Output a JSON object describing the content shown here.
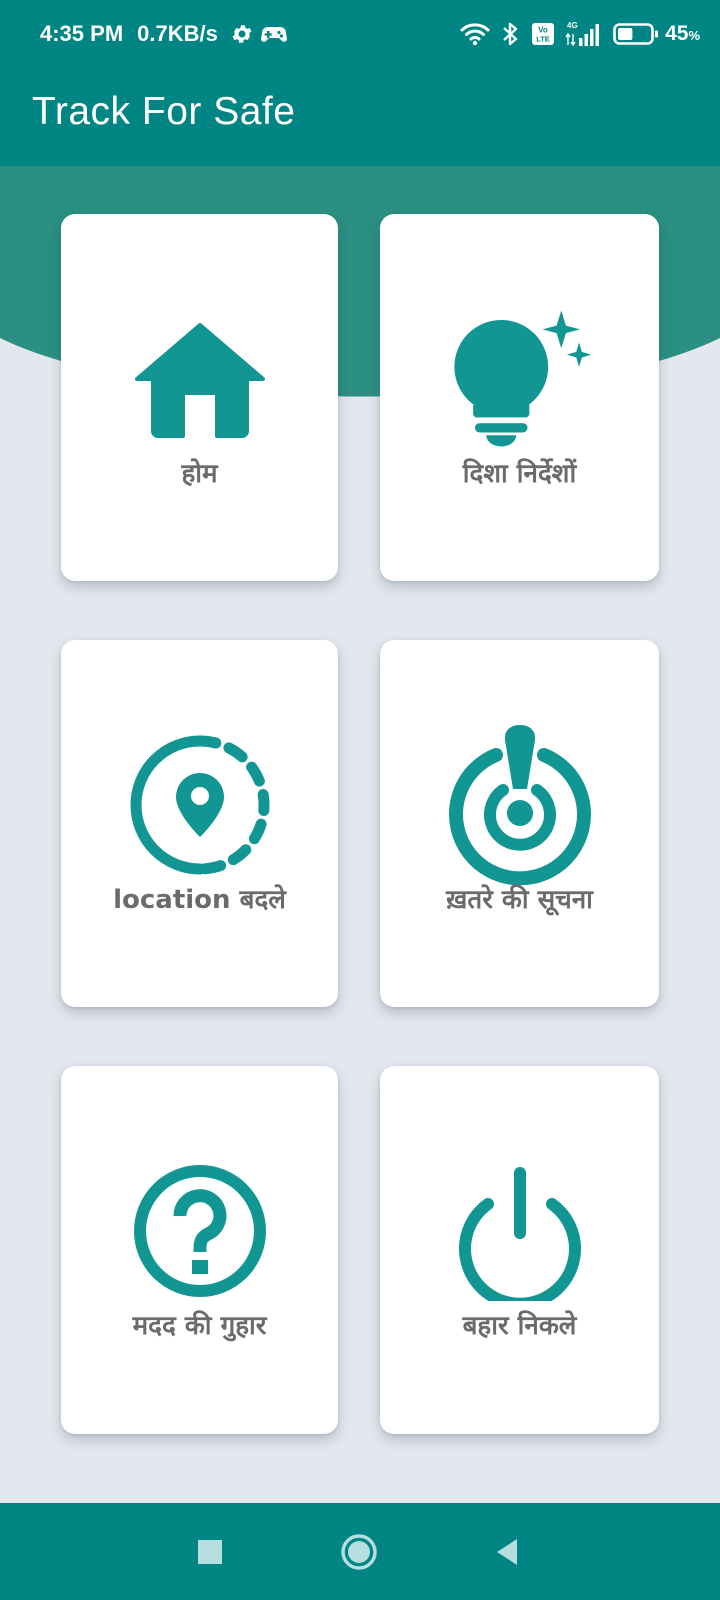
{
  "status_bar": {
    "time": "4:35 PM",
    "network_speed": "0.7KB/s",
    "battery_percent": "45",
    "battery_unit": "%",
    "battery_level": 0.45,
    "network_type": "4G",
    "volte_label": "Vo LTE",
    "icons": [
      "settings-icon",
      "game-controller-icon",
      "wifi-icon",
      "bluetooth-icon",
      "volte-icon",
      "signal-icon",
      "battery-icon"
    ]
  },
  "app_bar": {
    "title": "Track For Safe"
  },
  "tiles": [
    {
      "label": "होम",
      "icon": "home-icon"
    },
    {
      "label": "दिशा निर्देशों",
      "icon": "lightbulb-sparkle-icon"
    },
    {
      "label": "location बदले",
      "icon": "location-change-icon"
    },
    {
      "label": "ख़तरे की सूचना",
      "icon": "danger-alert-icon"
    },
    {
      "label": "मदद की गुहार",
      "icon": "help-icon"
    },
    {
      "label": "बहार निकले",
      "icon": "power-icon"
    }
  ],
  "navigation": {
    "buttons": [
      "recents-button",
      "home-button",
      "back-button"
    ]
  },
  "colors": {
    "primary": "#008585",
    "header_curve": "#2b8f82",
    "accent_icon": "#129694",
    "background": "#e3e7ee",
    "card": "#ffffff",
    "label_text": "#6b6b6b"
  }
}
